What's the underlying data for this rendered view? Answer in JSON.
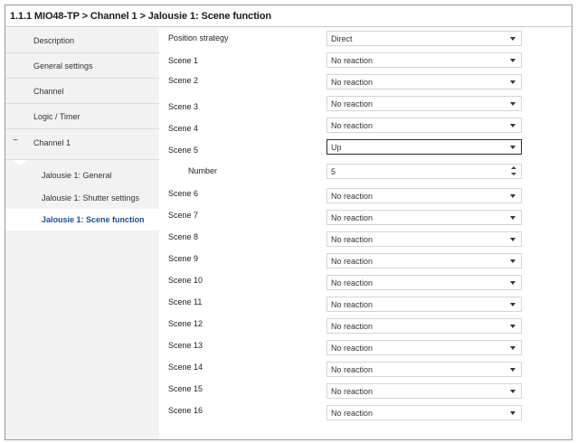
{
  "title": "1.1.1 MIO48-TP > Channel 1 > Jalousie 1: Scene function",
  "sidebar": {
    "items": [
      {
        "label": "Description"
      },
      {
        "label": "General settings"
      },
      {
        "label": "Channel"
      },
      {
        "label": "Logic / Timer"
      },
      {
        "label": "Channel 1",
        "collapse_symbol": "−"
      },
      {
        "label": "Jalousie 1: General"
      },
      {
        "label": "Jalousie 1: Shutter settings"
      },
      {
        "label": "Jalousie 1: Scene function"
      }
    ]
  },
  "params": [
    {
      "label": "Position strategy",
      "value": "Direct"
    },
    {
      "label": "Scene 1",
      "value": "No reaction"
    },
    {
      "label": "Scene 2",
      "value": "No reaction"
    },
    {
      "label": "Scene 3",
      "value": "No reaction"
    },
    {
      "label": "Scene 4",
      "value": "No reaction"
    },
    {
      "label": "Scene 5",
      "value": "Up"
    },
    {
      "label": "Number",
      "value": "5"
    },
    {
      "label": "Scene 6",
      "value": "No reaction"
    },
    {
      "label": "Scene 7",
      "value": "No reaction"
    },
    {
      "label": "Scene 8",
      "value": "No reaction"
    },
    {
      "label": "Scene 9",
      "value": "No reaction"
    },
    {
      "label": "Scene 10",
      "value": "No reaction"
    },
    {
      "label": "Scene 11",
      "value": "No reaction"
    },
    {
      "label": "Scene 12",
      "value": "No reaction"
    },
    {
      "label": "Scene 13",
      "value": "No reaction"
    },
    {
      "label": "Scene 14",
      "value": "No reaction"
    },
    {
      "label": "Scene 15",
      "value": "No reaction"
    },
    {
      "label": "Scene 16",
      "value": "No reaction"
    }
  ],
  "colors": {
    "sidebar_bg": "#f2f2f2",
    "active_text": "#1f4e8c",
    "field_border": "#d4d4d4",
    "focus_border": "#2b2b2b"
  }
}
